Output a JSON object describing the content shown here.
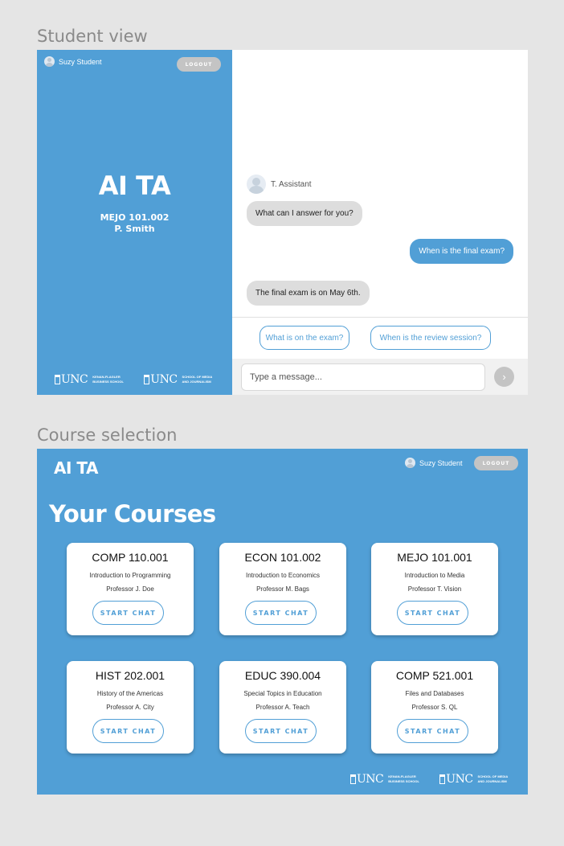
{
  "sections": {
    "student_view_label": "Student view",
    "course_selection_label": "Course selection"
  },
  "student_view": {
    "user_name": "Suzy Student",
    "logout_label": "LOGOUT",
    "app_title": "AI TA",
    "course_code": "MEJO 101.002",
    "professor": "P. Smith",
    "logos": [
      {
        "mark": "UNC",
        "text": "KENAN-FLAGLER BUSINESS SCHOOL"
      },
      {
        "mark": "UNC",
        "text": "SCHOOL OF MEDIA AND JOURNALISM"
      }
    ],
    "assistant_name": "T. Assistant",
    "messages": [
      {
        "from": "assistant",
        "text": "What can I answer for you?"
      },
      {
        "from": "user",
        "text": "When is the final exam?"
      },
      {
        "from": "assistant",
        "text": "The final exam is on May 6th."
      }
    ],
    "suggestions": [
      "What is on the exam?",
      "When is the review session?"
    ],
    "input_placeholder": "Type a message...",
    "send_icon": "chevron-right-icon"
  },
  "course_selection": {
    "brand": "AI TA",
    "user_name": "Suzy Student",
    "logout_label": "LOGOUT",
    "heading": "Your Courses",
    "start_label": "START CHAT",
    "courses": [
      {
        "code": "COMP 110.001",
        "name": "Introduction to Programming",
        "professor": "Professor J. Doe"
      },
      {
        "code": "ECON 101.002",
        "name": "Introduction to Economics",
        "professor": "Professor M. Bags"
      },
      {
        "code": "MEJO 101.001",
        "name": "Introduction to Media",
        "professor": "Professor T. Vision"
      },
      {
        "code": "HIST 202.001",
        "name": "History of the Americas",
        "professor": "Professor A. City"
      },
      {
        "code": "EDUC 390.004",
        "name": "Special Topics in Education",
        "professor": "Professor A. Teach"
      },
      {
        "code": "COMP 521.001",
        "name": "Files and Databases",
        "professor": "Professor S. QL"
      }
    ],
    "logos": [
      {
        "mark": "UNC",
        "text": "KENAN-FLAGLER BUSINESS SCHOOL"
      },
      {
        "mark": "UNC",
        "text": "SCHOOL OF MEDIA AND JOURNALISM"
      }
    ]
  },
  "colors": {
    "brand_blue": "#519fd6",
    "logout_gray": "#c4c4c4",
    "page_bg": "#e5e5e5"
  }
}
